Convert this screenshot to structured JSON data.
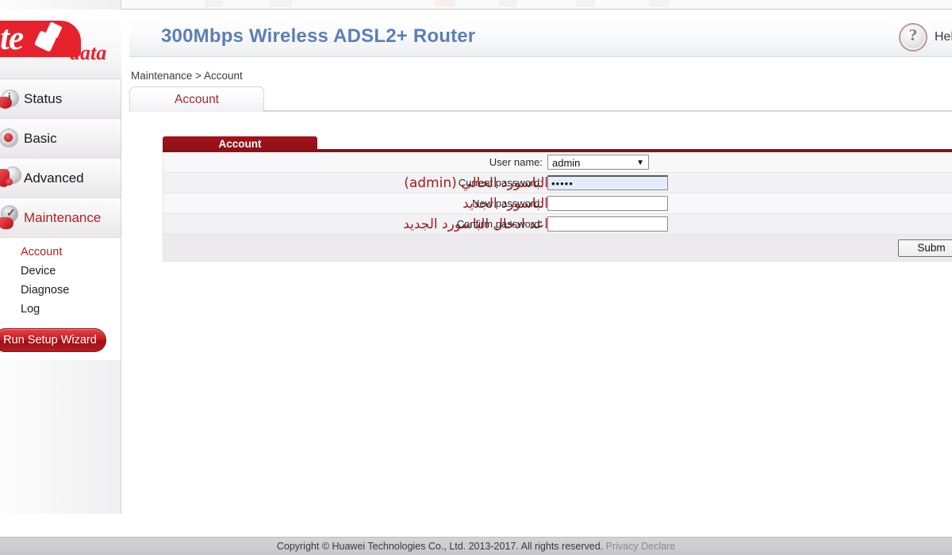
{
  "brand": {
    "logo_text_primary": "te",
    "logo_text_secondary": "data"
  },
  "header": {
    "title": "300Mbps Wireless ADSL2+ Router",
    "help_label": "Hel",
    "help_icon": "question-mark-icon"
  },
  "breadcrumb": "Maintenance > Account",
  "tabs": [
    {
      "label": "Account",
      "active": true
    }
  ],
  "sidebar": {
    "items": [
      {
        "label": "Status",
        "icon": "info-bulb-icon",
        "active": false
      },
      {
        "label": "Basic",
        "icon": "gear-icon",
        "active": false
      },
      {
        "label": "Advanced",
        "icon": "tools-icon",
        "active": false
      },
      {
        "label": "Maintenance",
        "icon": "wrench-icon",
        "active": true
      }
    ],
    "submenu": [
      {
        "label": "Account",
        "active": true
      },
      {
        "label": "Device",
        "active": false
      },
      {
        "label": "Diagnose",
        "active": false
      },
      {
        "label": "Log",
        "active": false
      }
    ],
    "wizard_button": "Run Setup Wizard"
  },
  "panel": {
    "title": "Account",
    "rows": [
      {
        "label": "User name:",
        "note": "",
        "control": "select",
        "value": "admin",
        "options": [
          "admin"
        ]
      },
      {
        "label": "Current password:",
        "note": "الباسورد الحالي (admin)",
        "control": "password",
        "value": "•••••",
        "placeholder": "",
        "focused": true
      },
      {
        "label": "New password:",
        "note": "الباسورد الجديد",
        "control": "password",
        "value": "",
        "placeholder": "",
        "focused": false
      },
      {
        "label": "Confirm password:",
        "note": "اعد ادخال الباسورد الجديد",
        "control": "password",
        "value": "",
        "placeholder": "",
        "focused": false
      }
    ],
    "submit_label": "Subm"
  },
  "footer": {
    "copyright": "Copyright © Huawei Technologies Co., Ltd. 2013-2017. All rights reserved.",
    "privacy_label": "Privacy Declare"
  },
  "colors": {
    "brand_red": "#e8222c",
    "accent_dark_red": "#8d1016",
    "title_blue": "#5c7fb5",
    "note_red": "#9e1b20"
  }
}
